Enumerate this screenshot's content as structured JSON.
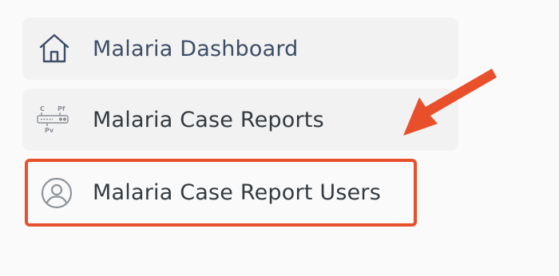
{
  "menu": {
    "items": [
      {
        "label": "Malaria Dashboard",
        "icon": "home-icon"
      },
      {
        "label": "Malaria Case Reports",
        "icon": "test-strip-icon"
      },
      {
        "label": "Malaria Case Report Users",
        "icon": "user-circle-icon"
      }
    ]
  },
  "test_strip": {
    "c_label": "C",
    "pf_label": "Pf",
    "pv_label": "Pv"
  },
  "colors": {
    "highlight": "#e8502b",
    "dashboard_text": "#3e4e66",
    "item_text": "#333a40",
    "item_bg": "#f2f2f2"
  }
}
